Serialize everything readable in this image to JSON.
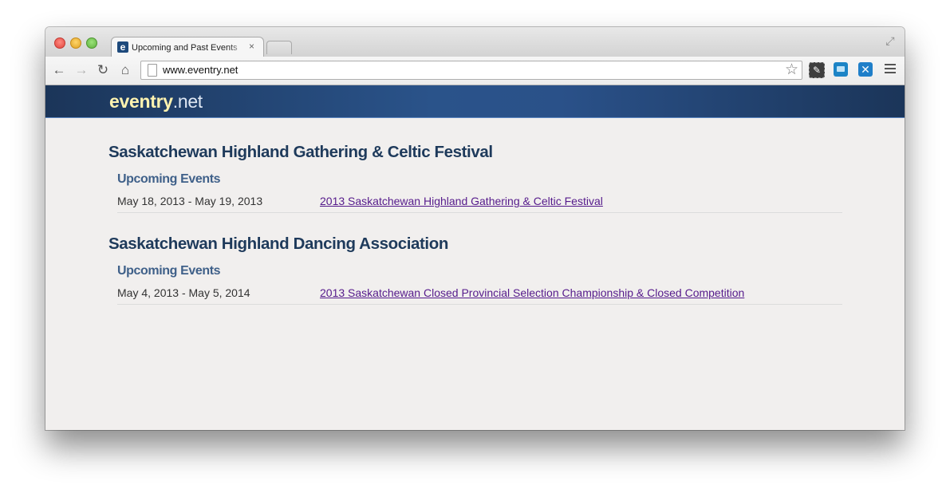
{
  "browser": {
    "tab": {
      "favicon": "e",
      "title": "Upcoming and Past Events",
      "close_icon": "×"
    },
    "toolbar": {
      "url": "www.eventry.net"
    }
  },
  "site": {
    "logo_strong": "eventry",
    "logo_light": ".net"
  },
  "sections": [
    {
      "title": "Saskatchewan Highland Gathering & Celtic Festival",
      "subtitle": "Upcoming Events",
      "events": [
        {
          "date": "May 18, 2013 - May 19, 2013",
          "name": "2013 Saskatchewan Highland Gathering & Celtic Festival"
        }
      ]
    },
    {
      "title": "Saskatchewan Highland Dancing Association",
      "subtitle": "Upcoming Events",
      "events": [
        {
          "date": "May 4, 2013 - May 5, 2014",
          "name": "2013 Saskatchewan Closed Provincial Selection Championship & Closed Competition"
        }
      ]
    }
  ],
  "icons": {
    "back": "back-arrow-icon",
    "forward": "forward-arrow-icon",
    "reload": "reload-icon",
    "home": "home-icon",
    "star": "bookmark-star-icon",
    "menu": "hamburger-menu-icon"
  }
}
